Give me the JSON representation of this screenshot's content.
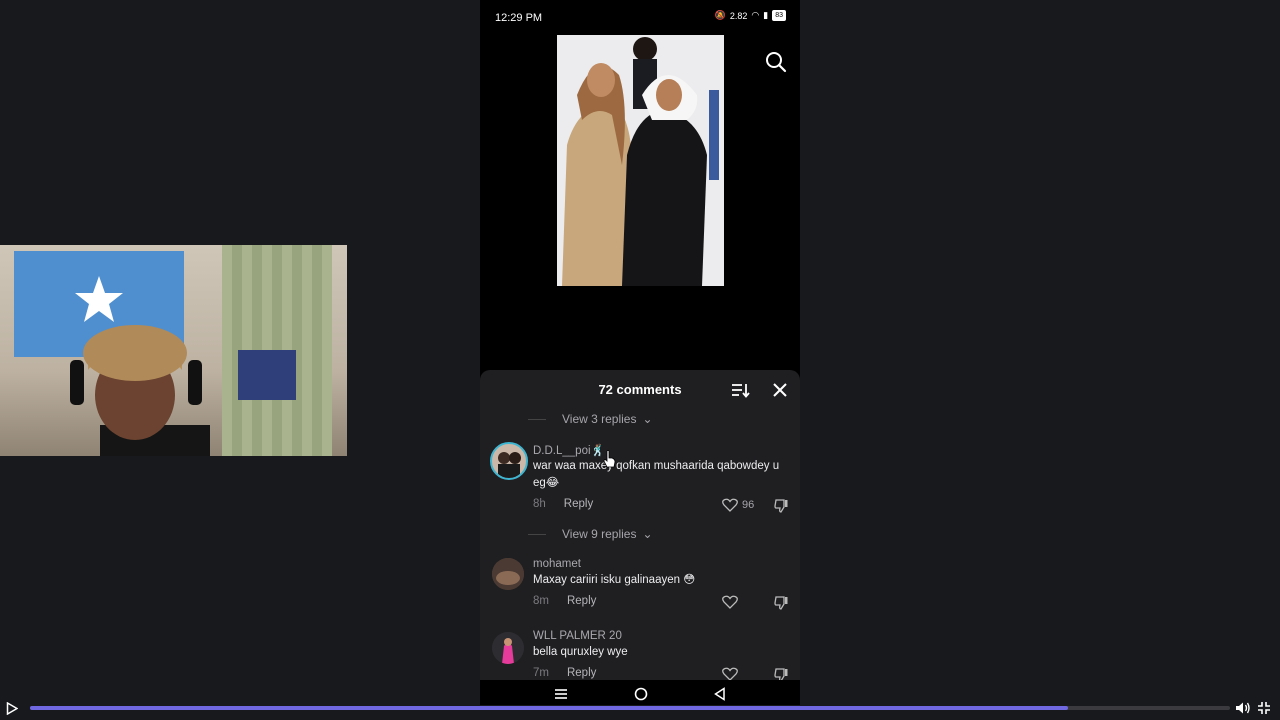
{
  "status_bar": {
    "time": "12:29 PM",
    "network_speed": "2.82",
    "battery": "83"
  },
  "icons": {
    "search": "search-icon",
    "sort": "sort-icon",
    "close": "close-icon",
    "like": "heart-icon",
    "dislike": "thumbs-down-icon",
    "play": "play-icon",
    "volume": "volume-icon",
    "fullscreen": "exit-fullscreen-icon"
  },
  "comments_sheet": {
    "title": "72 comments",
    "view_replies_1": "View 3 replies",
    "view_replies_2": "View 9 replies",
    "comments": [
      {
        "username": "D.D.L__poi🕺🏽",
        "text": "war waa maxey qofkan mushaarida qabowdey u eg😂",
        "time": "8h",
        "reply_label": "Reply",
        "likes": "96"
      },
      {
        "username": "mohamet",
        "text": "Maxay cariiri isku galinaayen 😳",
        "time": "8m",
        "reply_label": "Reply"
      },
      {
        "username": "WLL PALMER 20",
        "text": "bella quruxley wye",
        "time": "7m",
        "reply_label": "Reply"
      }
    ]
  },
  "player": {
    "progress": 0.865
  },
  "colors": {
    "accent": "#6f68e0",
    "sheet_bg": "#1f1f22",
    "flag_blue": "#4f8fd0"
  }
}
